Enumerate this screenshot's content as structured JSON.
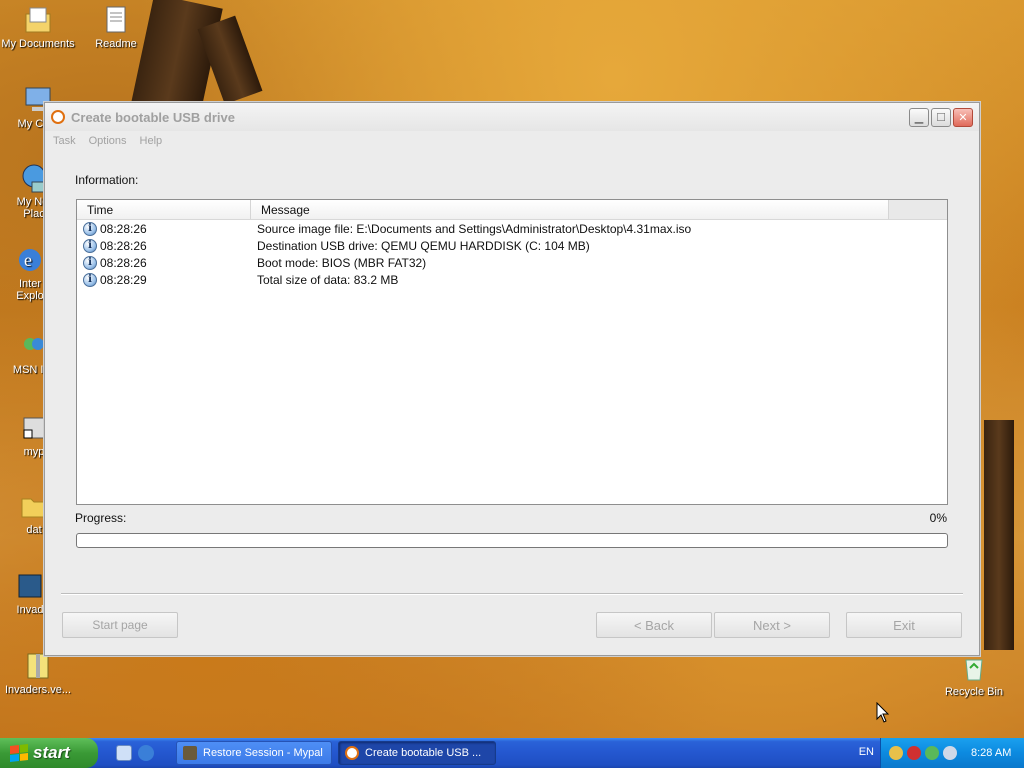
{
  "desktop": {
    "icons": [
      {
        "label": "My Documents",
        "icon": "my-documents-icon"
      },
      {
        "label": "Readme",
        "icon": "document-icon"
      },
      {
        "label": "My Com",
        "icon": "my-computer-icon"
      },
      {
        "label": "My Net",
        "icon": "network-icon"
      },
      {
        "label": "Plac",
        "icon": "network-icon"
      },
      {
        "label": "Inter",
        "icon": "internet-explorer-icon"
      },
      {
        "label": "Explo",
        "icon": "internet-explorer-icon"
      },
      {
        "label": "MSN Ins",
        "icon": "msn-icon"
      },
      {
        "label": "myp",
        "icon": "shortcut-icon"
      },
      {
        "label": "dat",
        "icon": "folder-icon"
      },
      {
        "label": "Invad",
        "icon": "game-icon"
      },
      {
        "label": "Invaders.ve...",
        "icon": "archive-icon"
      },
      {
        "label": "Recycle Bin",
        "icon": "recycle-bin-icon"
      }
    ]
  },
  "window": {
    "title": "Create bootable USB drive",
    "menu": [
      "Task",
      "Options",
      "Help"
    ],
    "information_label": "Information:",
    "columns": {
      "time": "Time",
      "message": "Message"
    },
    "log": [
      {
        "time": "08:28:26",
        "message": "Source image file: E:\\Documents and Settings\\Administrator\\Desktop\\4.31max.iso"
      },
      {
        "time": "08:28:26",
        "message": "Destination USB drive: QEMU QEMU HARDDISK (C:  104 MB)"
      },
      {
        "time": "08:28:26",
        "message": "Boot mode: BIOS (MBR FAT32)"
      },
      {
        "time": "08:28:29",
        "message": "Total size of data: 83.2 MB"
      }
    ],
    "progress_label": "Progress:",
    "progress_percent": "0%",
    "progress_fraction": 0,
    "buttons": {
      "start_page": "Start page",
      "back": "< Back",
      "next": "Next >",
      "exit": "Exit"
    }
  },
  "taskbar": {
    "start_label": "start",
    "tasks": [
      {
        "label": "Restore Session - Mypal",
        "icon": "mypal-icon"
      },
      {
        "label": "Create bootable USB ...",
        "icon": "usb-tool-icon"
      }
    ],
    "language": "EN",
    "clock": "8:28 AM"
  },
  "colors": {
    "start_green": "#3a9a36",
    "taskbar_blue": "#2457cf",
    "tray_blue": "#0c8ae0",
    "app_accent": "#e07010"
  }
}
